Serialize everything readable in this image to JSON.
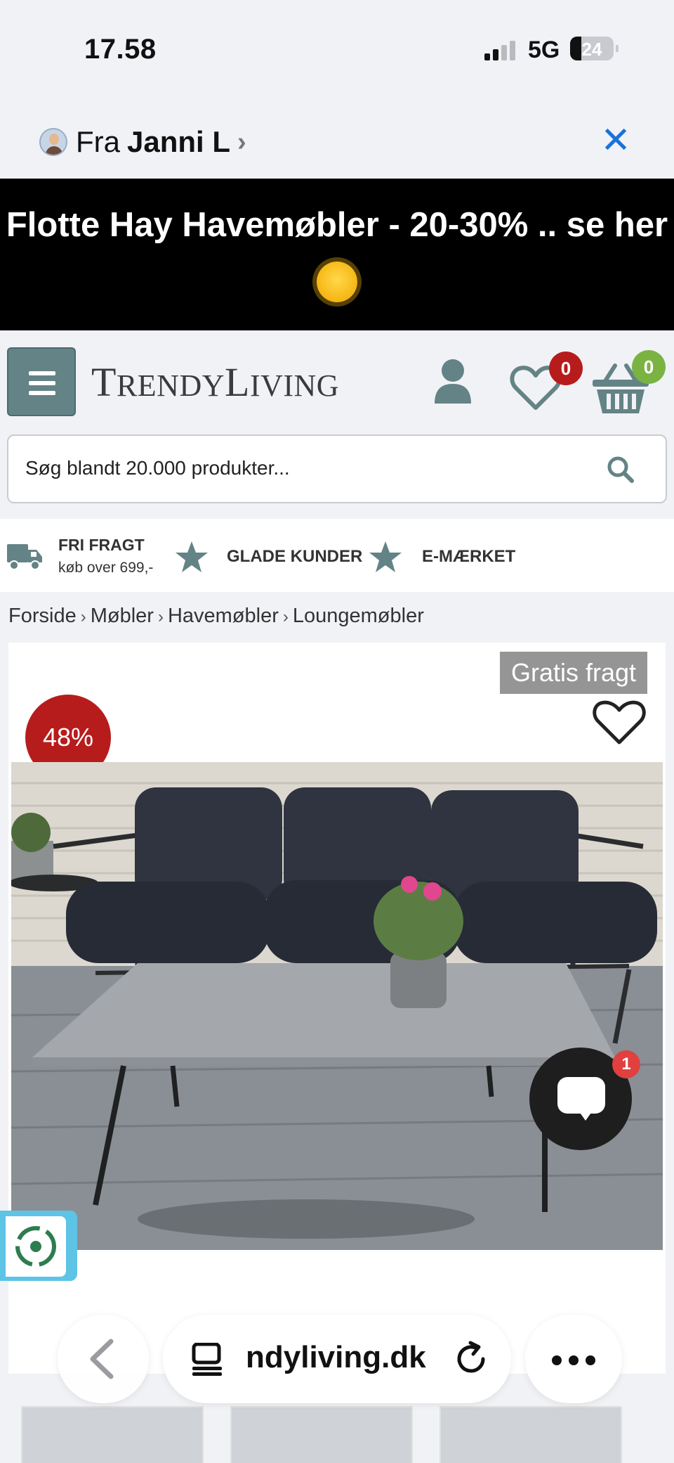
{
  "status_bar": {
    "time": "17.58",
    "network": "5G",
    "battery": "24"
  },
  "share_header": {
    "from_label": "Fra",
    "from_name": "Janni L",
    "chevron": "›",
    "close": "✕"
  },
  "promo_banner": {
    "text": "Flotte Hay Havemøbler - 20-30% .. se her",
    "emoji": "sun-face"
  },
  "header": {
    "logo_first_cap": "T",
    "logo_first_rest": "RENDY",
    "logo_second_cap": "L",
    "logo_second_rest": "IVING",
    "wishlist_count": "0",
    "cart_count": "0"
  },
  "search": {
    "placeholder": "Søg blandt 20.000 produkter..."
  },
  "usp": {
    "shipping_title": "FRI FRAGT",
    "shipping_sub": "køb over 699,-",
    "happy_customers": "GLADE KUNDER",
    "e_label": "E-MÆRKET"
  },
  "breadcrumb": [
    "Forside",
    "Møbler",
    "Havemøbler",
    "Loungemøbler"
  ],
  "breadcrumb_sep": "›",
  "product": {
    "shipping_tag": "Gratis fragt",
    "discount": "48%"
  },
  "chat": {
    "unread": "1"
  },
  "browser": {
    "url": "ndyliving.dk"
  },
  "colors": {
    "accent": "#648386",
    "sale_red": "#b71c1c",
    "cart_badge_green": "#7bb343",
    "banner_bg": "#000000",
    "link_blue": "#1a73d9"
  }
}
